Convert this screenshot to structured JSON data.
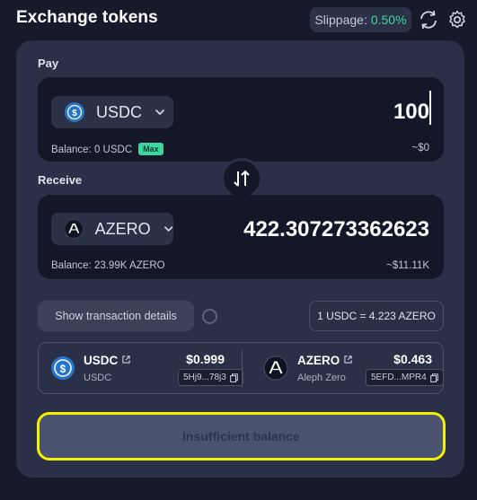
{
  "header": {
    "title": "Exchange tokens",
    "slippage_label": "Slippage:",
    "slippage_value": "0.50%"
  },
  "pay": {
    "label": "Pay",
    "token": "USDC",
    "amount": "100",
    "balance": "Balance: 0 USDC",
    "max_label": "Max",
    "usd_value": "~$0"
  },
  "receive": {
    "label": "Receive",
    "token": "AZERO",
    "amount": "422.307273362623",
    "balance": "Balance: 23.99K AZERO",
    "usd_value": "~$11.11K"
  },
  "details": {
    "toggle_label": "Show transaction details",
    "rate": "1 USDC = 4.223 AZERO"
  },
  "token_info": [
    {
      "symbol": "USDC",
      "name": "USDC",
      "price": "$0.999",
      "address": "5Hj9...78j3"
    },
    {
      "symbol": "AZERO",
      "name": "Aleph Zero",
      "price": "$0.463",
      "address": "5EFD...MPR4"
    }
  ],
  "submit": {
    "label": "Insufficient balance",
    "highlight_color": "#f2f200"
  },
  "colors": {
    "background": "#171a2a",
    "card": "#2a3047",
    "input_box": "#131728",
    "accent_green": "#3ed9a0",
    "usdc_blue": "#2775ca"
  },
  "icons": [
    "refresh-icon",
    "gear-icon",
    "usdc-icon",
    "azero-icon",
    "chevron-down-icon",
    "swap-arrows-icon",
    "external-link-icon",
    "copy-icon"
  ]
}
